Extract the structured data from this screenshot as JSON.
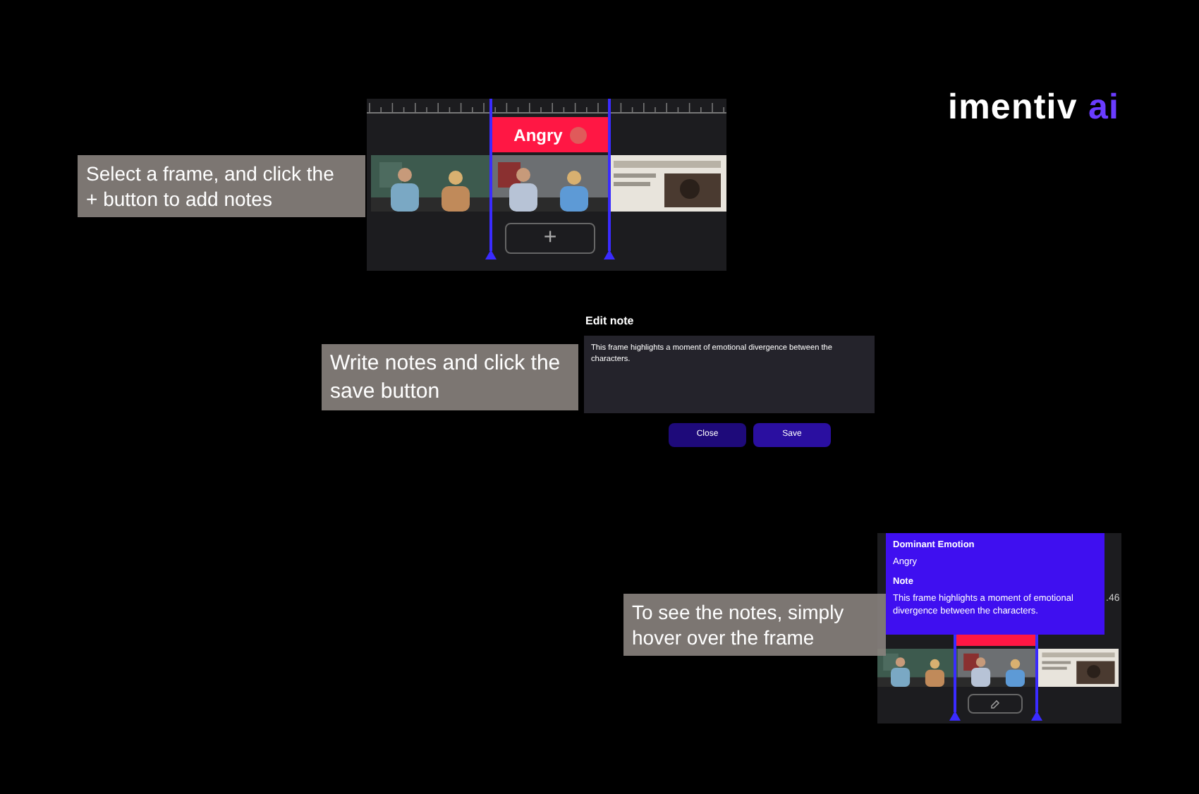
{
  "logo": {
    "text": "imentiv",
    "accent": "ai"
  },
  "callouts": [
    "Select a frame, and click the + button to add notes",
    "Write notes and click the save button",
    "To see the notes, simply hover over the frame"
  ],
  "timeline": {
    "emotion": "Angry",
    "add_button": "+"
  },
  "edit_note": {
    "title": "Edit note",
    "value": "This frame highlights a moment of emotional divergence between the characters.",
    "buttons": [
      "Close",
      "Save"
    ]
  },
  "hover": {
    "tooltip": [
      {
        "label": "Dominant Emotion",
        "value": "Angry"
      },
      {
        "label": "Note",
        "value": "This frame highlights a moment of emotional divergence between the characters."
      }
    ],
    "reading": ".46"
  }
}
